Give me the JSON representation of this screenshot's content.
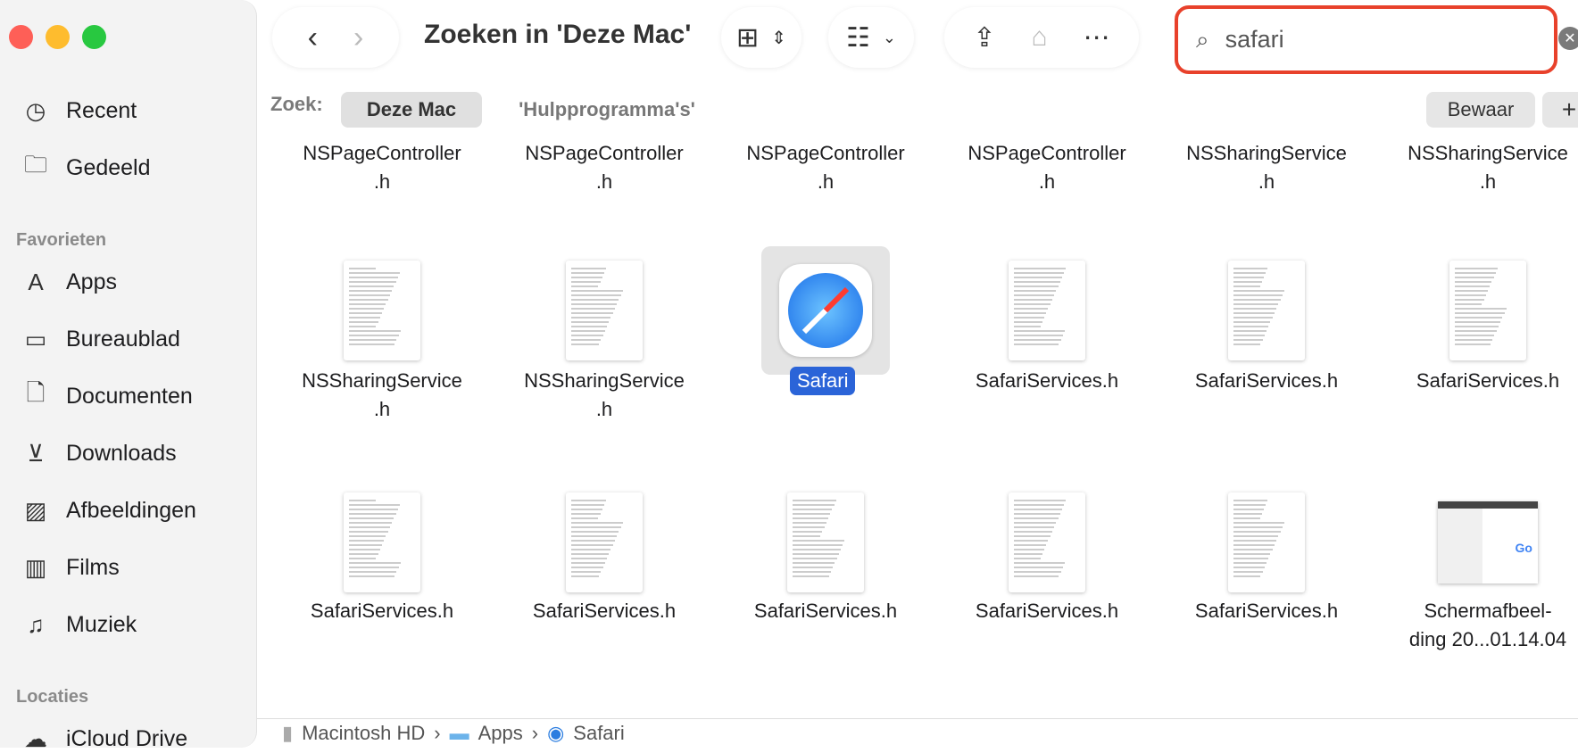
{
  "window": {
    "title": "Zoeken in 'Deze Mac'"
  },
  "sidebar": {
    "items": [
      {
        "label": "Recent",
        "icon": "clock-icon"
      },
      {
        "label": "Gedeeld",
        "icon": "shared-folder-icon"
      }
    ],
    "favorites_header": "Favorieten",
    "favorites": [
      {
        "label": "Apps",
        "icon": "apps-icon"
      },
      {
        "label": "Bureaublad",
        "icon": "desktop-icon"
      },
      {
        "label": "Documenten",
        "icon": "document-icon"
      },
      {
        "label": "Downloads",
        "icon": "download-icon"
      },
      {
        "label": "Afbeeldingen",
        "icon": "photo-icon"
      },
      {
        "label": "Films",
        "icon": "film-icon"
      },
      {
        "label": "Muziek",
        "icon": "music-icon"
      }
    ],
    "locations_header": "Locaties",
    "locations": [
      {
        "label": "iCloud Drive",
        "icon": "cloud-icon"
      }
    ]
  },
  "search": {
    "value": "safari"
  },
  "scope": {
    "label": "Zoek:",
    "options": [
      "Deze Mac",
      "'Hulpprogramma's'"
    ],
    "selected": "Deze Mac",
    "save": "Bewaar",
    "add": "+"
  },
  "files": {
    "row0": [
      "NSPageController\n.h",
      "NSPageController\n.h",
      "NSPageController\n.h",
      "NSPageController\n.h",
      "NSSharingService\n.h",
      "NSSharingService\n.h"
    ],
    "row1": [
      "NSSharingService\n.h",
      "NSSharingService\n.h",
      "Safari",
      "SafariServices.h",
      "SafariServices.h",
      "SafariServices.h"
    ],
    "row2": [
      "SafariServices.h",
      "SafariServices.h",
      "SafariServices.h",
      "SafariServices.h",
      "SafariServices.h",
      "Schermafbeel-\nding 20...01.14.04"
    ],
    "selected": "Safari"
  },
  "pathbar": [
    "Macintosh HD",
    "Apps",
    "Safari"
  ],
  "colors": {
    "accent": "#2b64d8",
    "search_highlight": "#e8412b"
  }
}
